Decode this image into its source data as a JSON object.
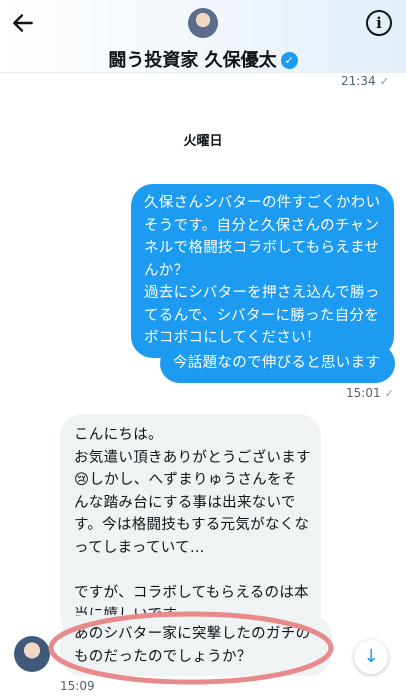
{
  "header": {
    "title": "闘う投資家 久保優太",
    "back_icon": "arrow-left-icon",
    "info_icon": "info-icon",
    "verified_icon": "verified-badge-icon",
    "info_glyph": "i",
    "verified_glyph": "✓"
  },
  "conversation": {
    "top_timestamp": "21:34",
    "day_separator": "火曜日",
    "sent_message_1": {
      "lines": [
        "久保さんシバターの件すごくかわい",
        "そうです。自分と久保さんのチャン",
        "ネルで格闘技コラボしてもらえませ",
        "んか？",
        "過去にシバターを押さえ込んで勝っ",
        "てるんで、シバターに勝った自分を",
        "ボコボコにしてください！"
      ]
    },
    "sent_message_2": {
      "text": "今話題なので伸びると思います"
    },
    "sent_timestamp": "15:01",
    "received_message_1": {
      "lines": [
        "こんにちは。",
        "お気遣い頂きありがとうございます",
        "😢しかし、へずまりゅうさんをそ",
        "んな踏み台にする事は出来ないで",
        "す。今は格闘技もする元気がなくな",
        "ってしまっていて…",
        "",
        "ですが、コラボしてもらえるのは本",
        "当に嬉しいです。"
      ]
    },
    "received_message_2": {
      "lines": [
        "あのシバター家に突撃したのガチの",
        "ものだったのでしょうか？"
      ]
    },
    "received_timestamp": "15:09",
    "scroll_glyph": "↓"
  },
  "colors": {
    "accent": "#1d9bf0",
    "incoming_bubble": "#eff3f4",
    "annotation": "#e8898b"
  }
}
